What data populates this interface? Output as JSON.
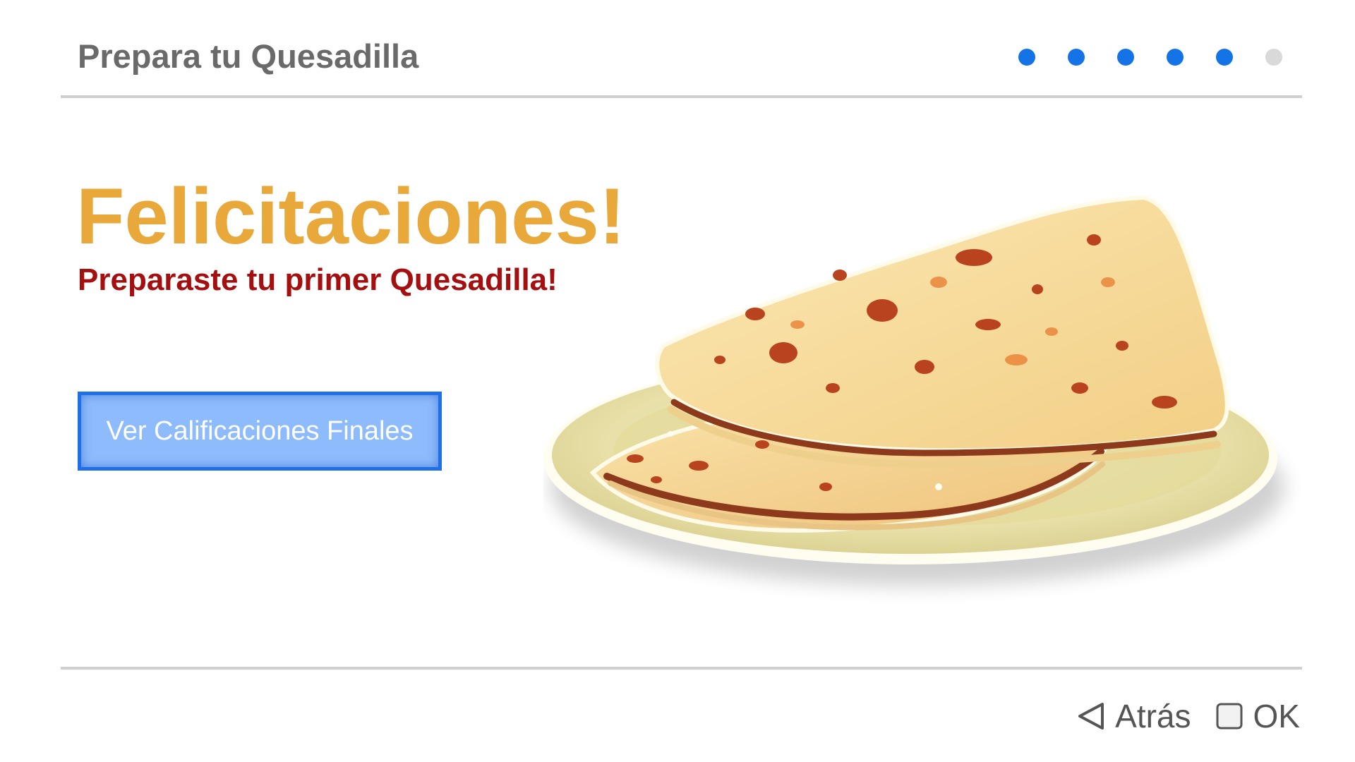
{
  "header": {
    "title": "Prepara tu Quesadilla",
    "progress": {
      "total_steps": 6,
      "completed_steps": 5,
      "active_color": "#1473e6",
      "inactive_color": "#d9d9d9"
    }
  },
  "main": {
    "headline": "Felicitaciones!",
    "subheadline": "Preparaste tu primer Quesadilla!",
    "cta_label": "Ver Calificaciones Finales",
    "illustration_icon": "quesadilla-plate-illustration"
  },
  "footer": {
    "back_label": "Atrás",
    "back_icon": "triangle-left-icon",
    "ok_label": "OK",
    "ok_icon": "square-icon"
  },
  "colors": {
    "headline": "#e8a83a",
    "subheadline": "#a50f0f",
    "button_fill": "#8ebbfb",
    "button_border": "#1e6fe8"
  }
}
